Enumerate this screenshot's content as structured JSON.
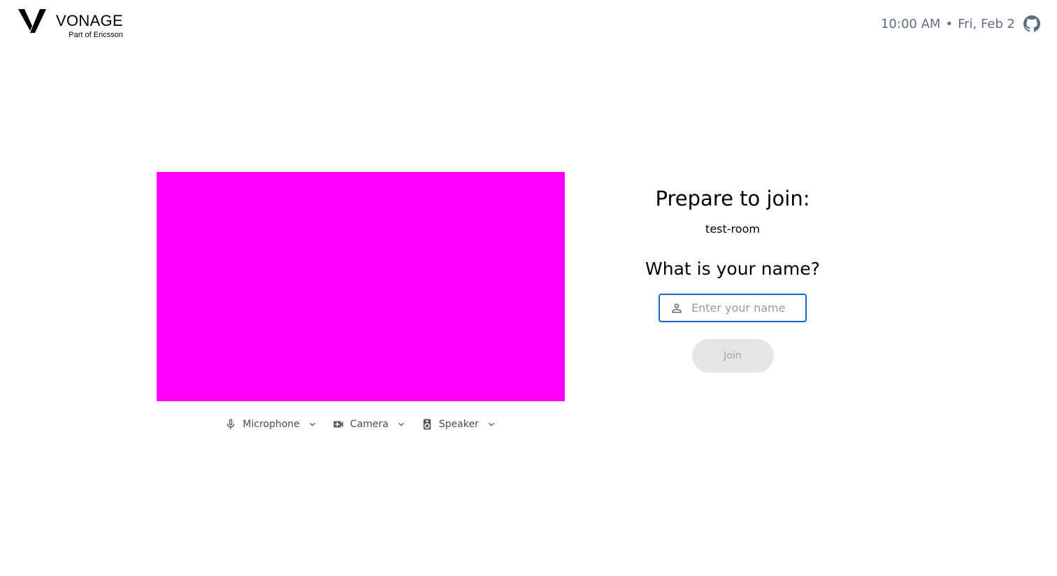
{
  "header": {
    "brand": "VONAGE",
    "brand_sub": "Part of Ericsson",
    "time": "10:00 AM",
    "separator": "•",
    "date": "Fri, Feb 2",
    "github_icon": "github-icon"
  },
  "preview": {
    "color": "#ff00ff"
  },
  "devices": [
    {
      "label": "Microphone",
      "icon": "microphone-icon"
    },
    {
      "label": "Camera",
      "icon": "video-camera-icon"
    },
    {
      "label": "Speaker",
      "icon": "speaker-icon"
    }
  ],
  "form": {
    "title": "Prepare to join:",
    "room": "test-room",
    "question": "What is your name?",
    "name_placeholder": "Enter your name",
    "name_value": "",
    "join_label": "Join"
  },
  "colors": {
    "accent": "#1a64c8",
    "datetime": "#5e6d82",
    "join_disabled_bg": "#e6e6e6"
  }
}
